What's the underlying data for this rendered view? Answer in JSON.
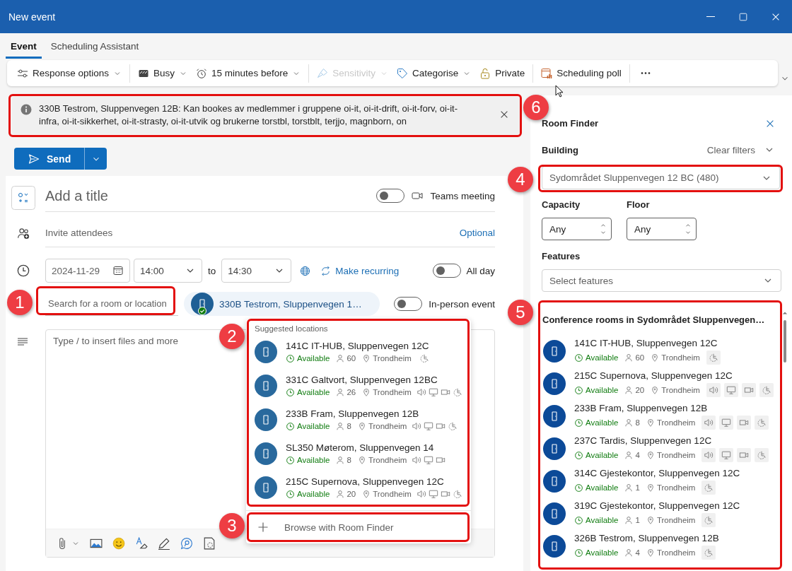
{
  "window": {
    "title": "New event"
  },
  "tabs": [
    {
      "label": "Event",
      "selected": true
    },
    {
      "label": "Scheduling Assistant",
      "selected": false
    }
  ],
  "toolbar": [
    {
      "label": "Response options",
      "menu": true,
      "disabled": false,
      "divider_after": true
    },
    {
      "label": "Busy",
      "menu": true,
      "disabled": false,
      "divider_after": false
    },
    {
      "label": "15 minutes before",
      "menu": true,
      "disabled": false,
      "divider_after": true
    },
    {
      "label": "Sensitivity",
      "menu": true,
      "disabled": true,
      "divider_after": false
    },
    {
      "label": "Categorise",
      "menu": true,
      "disabled": false,
      "divider_after": false
    },
    {
      "label": "Private",
      "menu": false,
      "disabled": false,
      "divider_after": true
    },
    {
      "label": "Scheduling poll",
      "menu": false,
      "disabled": false,
      "divider_after": true
    }
  ],
  "info_bar": {
    "text": "330B Testrom, Sluppenvegen 12B: Kan bookes av medlemmer i gruppene oi-it, oi-it-drift, oi-it-forv, oi-it-infra, oi-it-sikkerhet, oi-it-strasty, oi-it-utvik og brukerne torstbl, torstblt, terjjo, magnborn, on"
  },
  "send_button": {
    "label": "Send"
  },
  "form": {
    "title_placeholder": "Add a title",
    "teams": {
      "label": "Teams meeting",
      "on": false
    },
    "attendees": {
      "placeholder": "Invite attendees",
      "optional": "Optional"
    },
    "date": "2024-11-29",
    "start": "14:00",
    "to": "to",
    "end": "14:30",
    "recurring": "Make recurring",
    "all_day": {
      "label": "All day",
      "on": false
    },
    "location": {
      "placeholder": "Search for a room or location",
      "chip": "330B Testrom, Sluppenvegen 1…",
      "in_person": {
        "label": "In-person event",
        "on": false
      }
    },
    "body_placeholder": "Type / to insert files and more"
  },
  "suggestions": {
    "heading": "Suggested locations",
    "rooms": [
      {
        "name": "141C IT-HUB, Sluppenvegen 12C",
        "status": "Available",
        "capacity": "60",
        "city": "Trondheim",
        "audio": false,
        "display": false,
        "video": false,
        "accessible": true
      },
      {
        "name": "331C Galtvort, Sluppenvegen 12BC",
        "status": "Available",
        "capacity": "26",
        "city": "Trondheim",
        "audio": true,
        "display": true,
        "video": true,
        "accessible": true
      },
      {
        "name": "233B Fram, Sluppenvegen 12B",
        "status": "Available",
        "capacity": "8",
        "city": "Trondheim",
        "audio": true,
        "display": true,
        "video": true,
        "accessible": true
      },
      {
        "name": "SL350 Møterom, Sluppenvegen 14",
        "status": "Available",
        "capacity": "8",
        "city": "Trondheim",
        "audio": true,
        "display": true,
        "video": true,
        "accessible": false
      },
      {
        "name": "215C Supernova, Sluppenvegen 12C",
        "status": "Available",
        "capacity": "20",
        "city": "Trondheim",
        "audio": true,
        "display": true,
        "video": true,
        "accessible": true
      }
    ],
    "browse": "Browse with Room Finder"
  },
  "room_finder": {
    "title": "Room Finder",
    "building_label": "Building",
    "clear_filters": "Clear filters",
    "building": "Sydområdet Sluppenvegen 12 BC (480)",
    "capacity_label": "Capacity",
    "capacity": "Any",
    "floor_label": "Floor",
    "floor": "Any",
    "features_label": "Features",
    "features_placeholder": "Select features",
    "list_heading": "Conference rooms in Sydområdet Sluppenvegen…",
    "rooms": [
      {
        "name": "141C IT-HUB, Sluppenvegen 12C",
        "status": "Available",
        "capacity": "60",
        "city": "Trondheim",
        "audio": false,
        "display": false,
        "video": false,
        "accessible": true
      },
      {
        "name": "215C Supernova, Sluppenvegen 12C",
        "status": "Available",
        "capacity": "20",
        "city": "Trondheim",
        "audio": true,
        "display": true,
        "video": true,
        "accessible": true
      },
      {
        "name": "233B Fram, Sluppenvegen 12B",
        "status": "Available",
        "capacity": "8",
        "city": "Trondheim",
        "audio": true,
        "display": true,
        "video": true,
        "accessible": true
      },
      {
        "name": "237C Tardis, Sluppenvegen 12C",
        "status": "Available",
        "capacity": "4",
        "city": "Trondheim",
        "audio": true,
        "display": true,
        "video": true,
        "accessible": true
      },
      {
        "name": "314C Gjestekontor, Sluppenvegen 12C",
        "status": "Available",
        "capacity": "1",
        "city": "Trondheim",
        "audio": false,
        "display": false,
        "video": false,
        "accessible": true
      },
      {
        "name": "319C Gjestekontor, Sluppenvegen 12C",
        "status": "Available",
        "capacity": "1",
        "city": "Trondheim",
        "audio": false,
        "display": false,
        "video": false,
        "accessible": true
      },
      {
        "name": "326B Testrom, Sluppenvegen 12B",
        "status": "Available",
        "capacity": "4",
        "city": "Trondheim",
        "audio": false,
        "display": false,
        "video": false,
        "accessible": true
      }
    ]
  },
  "annotations": [
    {
      "number": "1"
    },
    {
      "number": "2"
    },
    {
      "number": "3"
    },
    {
      "number": "4"
    },
    {
      "number": "5"
    },
    {
      "number": "6"
    }
  ]
}
